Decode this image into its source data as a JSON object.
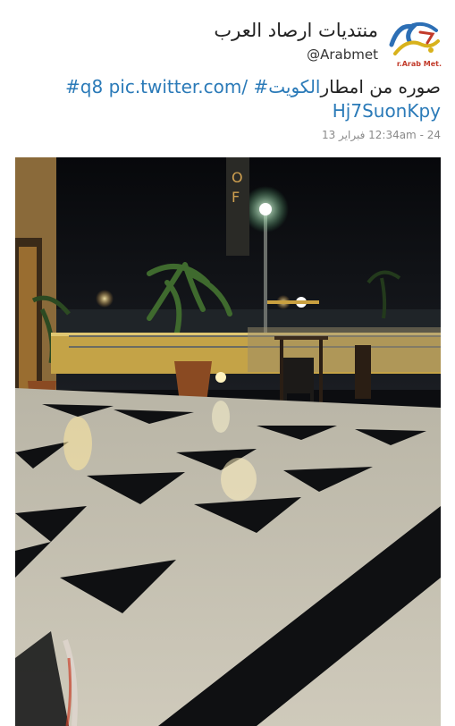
{
  "account": {
    "display_name": "منتديات ارصاد العرب",
    "handle": "@Arabmet",
    "avatar_caption": "r.Arab Met."
  },
  "tweet": {
    "text_line1_prefix": "صوره من امطار ",
    "text_line1_links": "#q8 pic.twitter.com/ #الكويت",
    "text_line2_link": "Hj7SuonKpy",
    "timestamp": "24 - 12:34am فبراير 13"
  },
  "colors": {
    "link": "#2a7ab8",
    "meta": "#8a8a8a"
  }
}
